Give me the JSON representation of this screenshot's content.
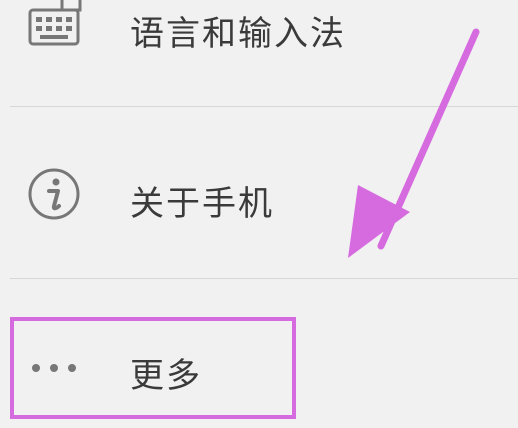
{
  "settings_list": {
    "items": [
      {
        "label": "语言和输入法",
        "icon": "keyboard-icon"
      },
      {
        "label": "关于手机",
        "icon": "info-icon"
      },
      {
        "label": "更多",
        "icon": "more-dots-icon"
      }
    ]
  },
  "annotation": {
    "highlight_color": "#d56bde",
    "arrow_color": "#d56bde"
  }
}
